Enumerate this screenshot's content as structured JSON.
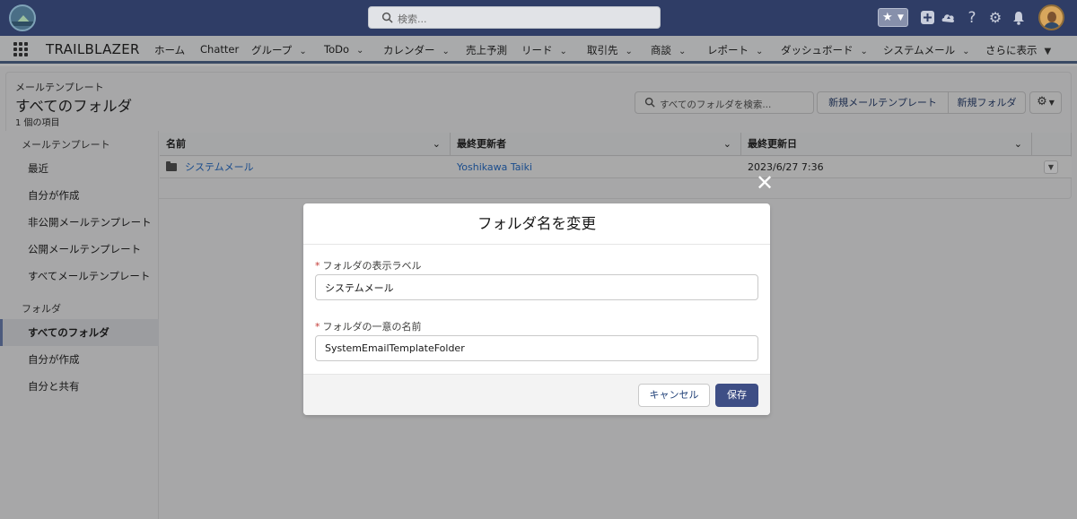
{
  "global_header": {
    "search_placeholder": "検索...",
    "utility_icons": [
      "star-icon",
      "chevron-down-icon",
      "add-icon",
      "trailhead-icon",
      "help-icon",
      "setup-gear-icon",
      "bell-icon",
      "avatar"
    ]
  },
  "nav": {
    "app_name": "TRAILBLAZER",
    "items": [
      {
        "label": "ホーム",
        "dropdown": false
      },
      {
        "label": "Chatter",
        "dropdown": false
      },
      {
        "label": "グループ",
        "dropdown": true
      },
      {
        "label": "ToDo",
        "dropdown": true
      },
      {
        "label": "カレンダー",
        "dropdown": true
      },
      {
        "label": "売上予測",
        "dropdown": false
      },
      {
        "label": "リード",
        "dropdown": true
      },
      {
        "label": "取引先",
        "dropdown": true
      },
      {
        "label": "商談",
        "dropdown": true
      },
      {
        "label": "レポート",
        "dropdown": true
      },
      {
        "label": "ダッシュボード",
        "dropdown": true
      },
      {
        "label": "システムメール",
        "dropdown": true
      },
      {
        "label": "さらに表示",
        "dropdown": true
      }
    ]
  },
  "page_header": {
    "kicker": "メールテンプレート",
    "title": "すべてのフォルダ",
    "count": "1 個の項目",
    "search_placeholder": "すべてのフォルダを検索...",
    "new_template_button": "新規メールテンプレート",
    "new_folder_button": "新規フォルダ"
  },
  "sidebar": {
    "section1": "メールテンプレート",
    "items1": [
      "最近",
      "自分が作成",
      "非公開メールテンプレート",
      "公開メールテンプレート",
      "すべてメールテンプレート"
    ],
    "section2": "フォルダ",
    "items2": [
      "すべてのフォルダ",
      "自分が作成",
      "自分と共有"
    ],
    "active": "すべてのフォルダ"
  },
  "table": {
    "columns": [
      "名前",
      "最終更新者",
      "最終更新日"
    ],
    "rows": [
      {
        "name": "システムメール",
        "modified_by": "Yoshikawa Taiki",
        "modified_date": "2023/6/27 7:36"
      }
    ]
  },
  "modal": {
    "title": "フォルダ名を変更",
    "label_field": "フォルダの表示ラベル",
    "label_value": "システムメール",
    "name_field": "フォルダの一意の名前",
    "name_value": "SystemEmailTemplateFolder",
    "cancel": "キャンセル",
    "save": "保存"
  },
  "colors": {
    "header_bg": "#2f3d66",
    "brand_button": "#3e4e85",
    "required": "#c23934",
    "link": "#1a4c8c"
  }
}
